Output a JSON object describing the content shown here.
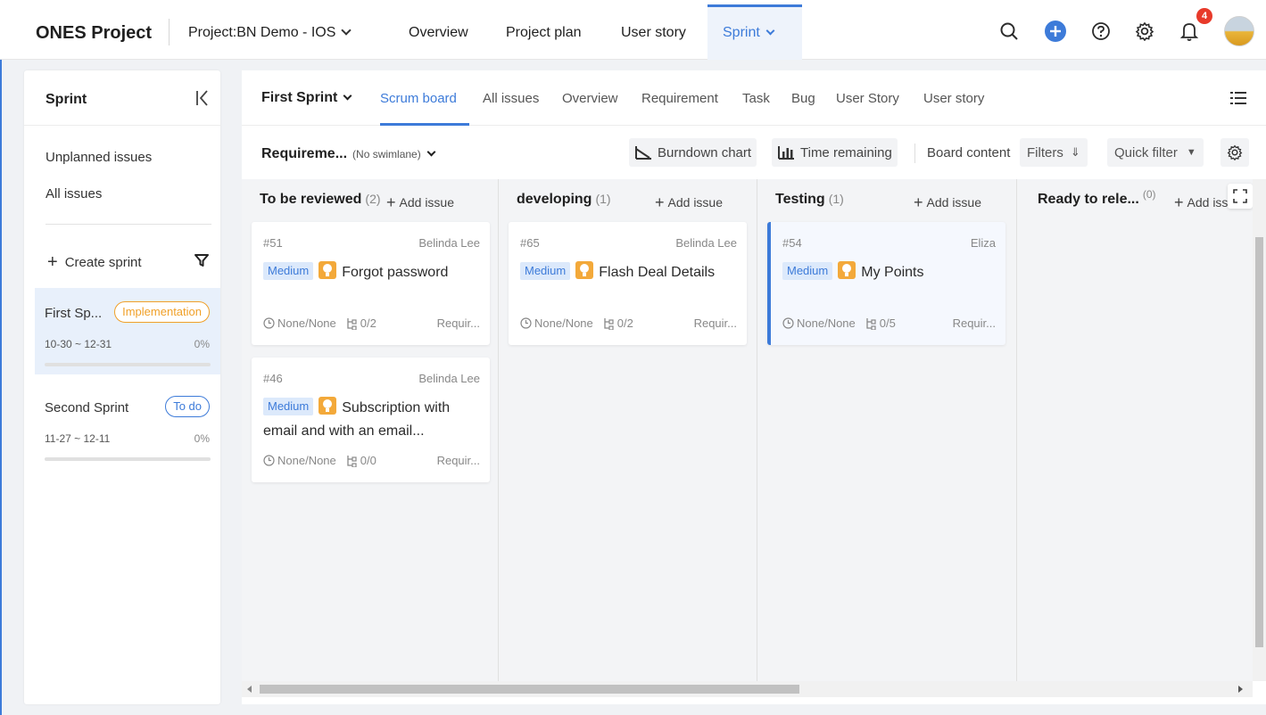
{
  "topnav": {
    "brand": "ONES Project",
    "project": "Project:BN Demo - IOS",
    "tabs": [
      "Overview",
      "Project plan",
      "User story",
      "Sprint"
    ],
    "active_tab": "Sprint",
    "notification_count": "4"
  },
  "sidebar": {
    "title": "Sprint",
    "links": [
      "Unplanned issues",
      "All issues"
    ],
    "create_label": "Create sprint",
    "sprints": [
      {
        "name": "First Sp...",
        "status": "Implementation",
        "dates": "10-30 ~ 12-31",
        "progress": "0%"
      },
      {
        "name": "Second Sprint",
        "status": "To do",
        "dates": "11-27 ~ 12-11",
        "progress": "0%"
      }
    ]
  },
  "subnav": {
    "sprint": "First Sprint",
    "tabs": [
      "Scrum board",
      "All issues",
      "Overview",
      "Requirement",
      "Task",
      "Bug",
      "User Story",
      "User story"
    ],
    "active_tab": "Scrum board"
  },
  "toolbar": {
    "group": "Requireme...",
    "swimlane": "(No swimlane)",
    "burndown": "Burndown chart",
    "time_remaining": "Time remaining",
    "board_content": "Board content",
    "filters": "Filters",
    "quick_filter": "Quick filter"
  },
  "columns": [
    {
      "title": "To be reviewed",
      "count": "(2)",
      "add": "Add issue",
      "cards": [
        {
          "number": "#51",
          "assignee": "Belinda Lee",
          "priority": "Medium",
          "title": "Forgot password",
          "time": "None/None",
          "subtasks": "0/2",
          "type": "Requir..."
        },
        {
          "number": "#46",
          "assignee": "Belinda Lee",
          "priority": "Medium",
          "title": "Subscription with email and with an email...",
          "time": "None/None",
          "subtasks": "0/0",
          "type": "Requir..."
        }
      ]
    },
    {
      "title": "developing",
      "count": "(1)",
      "add": "Add issue",
      "cards": [
        {
          "number": "#65",
          "assignee": "Belinda Lee",
          "priority": "Medium",
          "title": "Flash Deal Details",
          "time": "None/None",
          "subtasks": "0/2",
          "type": "Requir..."
        }
      ]
    },
    {
      "title": "Testing",
      "count": "(1)",
      "add": "Add issue",
      "cards": [
        {
          "number": "#54",
          "assignee": "Eliza",
          "priority": "Medium",
          "title": "My Points",
          "time": "None/None",
          "subtasks": "0/5",
          "type": "Requir..."
        }
      ]
    },
    {
      "title": "Ready to rele...",
      "count": "(0)",
      "add": "Add issu",
      "cards": []
    }
  ],
  "colors": {
    "accent": "#3d7bd9",
    "implementation": "#f0a028",
    "badge": "#e83a2a"
  },
  "icons": [
    "search-icon",
    "plus-circle-icon",
    "help-icon",
    "gear-icon",
    "bell-icon",
    "collapse-icon",
    "filter-icon",
    "menu-list-icon",
    "burndown-icon",
    "bar-chart-icon",
    "expand-icon",
    "clock-icon",
    "subtask-icon",
    "requirement-bulb-icon"
  ]
}
